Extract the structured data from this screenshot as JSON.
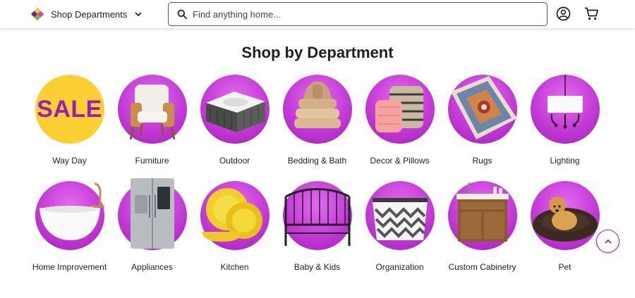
{
  "header": {
    "departments_label": "Shop Departments",
    "search_placeholder": "Find anything home...",
    "icons": {
      "logo": "wayfair-logo-icon",
      "chevron": "chevron-down-icon",
      "search": "search-icon",
      "account": "account-icon",
      "cart": "cart-icon"
    }
  },
  "main": {
    "title": "Shop by Department",
    "departments": [
      {
        "label": "Way Day",
        "badge": "SALE"
      },
      {
        "label": "Furniture"
      },
      {
        "label": "Outdoor"
      },
      {
        "label": "Bedding & Bath"
      },
      {
        "label": "Decor & Pillows"
      },
      {
        "label": "Rugs"
      },
      {
        "label": "Lighting"
      },
      {
        "label": "Home Improvement"
      },
      {
        "label": "Appliances"
      },
      {
        "label": "Kitchen"
      },
      {
        "label": "Baby & Kids"
      },
      {
        "label": "Organization"
      },
      {
        "label": "Custom Cabinetry"
      },
      {
        "label": "Pet"
      }
    ]
  },
  "controls": {
    "scroll_top_icon": "chevron-up-icon"
  },
  "colors": {
    "accent_purple": "#c43ad6",
    "sale_yellow": "#fcd034",
    "sale_text": "#9b1fb0"
  }
}
